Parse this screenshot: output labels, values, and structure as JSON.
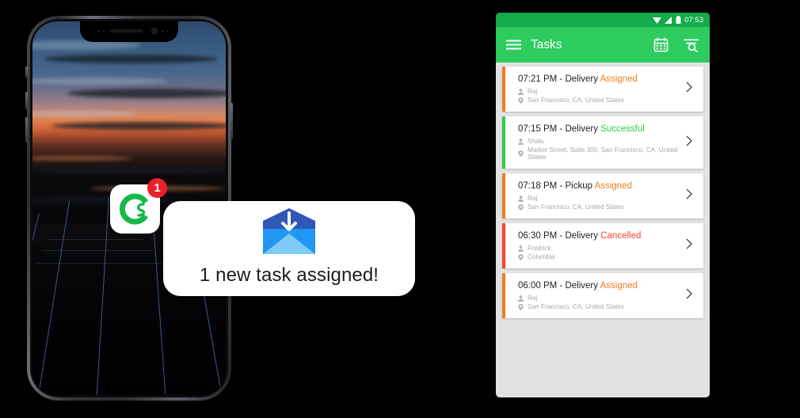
{
  "phone": {
    "notification": {
      "app_icon_name": "tookan-app-icon",
      "badge_count": "1",
      "message": "1 new task assigned!",
      "envelope_icon": "envelope-download-icon"
    }
  },
  "panel": {
    "statusbar": {
      "wifi_icon": "wifi-icon",
      "signal_icon": "signal-icon",
      "battery_icon": "battery-icon",
      "time": "07:53"
    },
    "toolbar": {
      "menu_icon": "hamburger-menu-icon",
      "title": "Tasks",
      "calendar_icon": "calendar-icon",
      "filter_icon": "filter-search-icon"
    },
    "colors": {
      "assigned": "#f47b20",
      "successful": "#2ecc4b",
      "cancelled": "#f4442e",
      "toolbar_green": "#2ecc5f",
      "statusbar_green": "#14ab4a",
      "panel_bg": "#e2e2e2"
    },
    "tasks": [
      {
        "time": "07:21 PM",
        "type": "Delivery",
        "separator": " - ",
        "status": "Assigned",
        "status_color": "#f47b20",
        "stripe_color": "#f47b20",
        "agent": "Raj",
        "address": "San Francisco, CA, United States"
      },
      {
        "time": "07:15 PM",
        "type": "Delivery",
        "separator": " - ",
        "status": "Successful",
        "status_color": "#2ecc4b",
        "stripe_color": "#2ecc4b",
        "agent": "Shalu",
        "address": "Market Street, Suite 300, San Francisco, CA, United States"
      },
      {
        "time": "07:18 PM",
        "type": "Pickup",
        "separator": " - ",
        "status": "Assigned",
        "status_color": "#f47b20",
        "stripe_color": "#f47b20",
        "agent": "Raj",
        "address": "San Francisco, CA, United States"
      },
      {
        "time": "06:30 PM",
        "type": "Delivery",
        "separator": " - ",
        "status": "Cancelled",
        "status_color": "#f4442e",
        "stripe_color": "#f4442e",
        "agent": "Fredrick",
        "address": "Columbia"
      },
      {
        "time": "06:00 PM",
        "type": "Delivery",
        "separator": " - ",
        "status": "Assigned",
        "status_color": "#f47b20",
        "stripe_color": "#f47b20",
        "agent": "Raj",
        "address": "San Francisco, CA, United States"
      }
    ]
  }
}
